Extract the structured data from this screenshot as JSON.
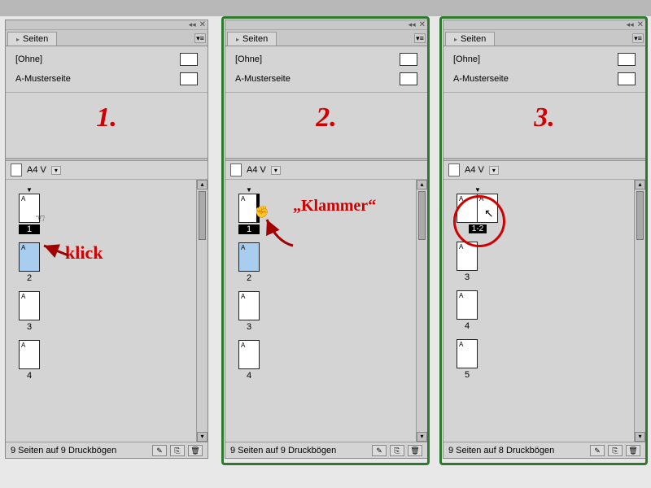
{
  "panel_title": "Seiten",
  "masters": {
    "none": "[Ohne]",
    "master_a": "A-Musterseite"
  },
  "format": {
    "label": "A4 V"
  },
  "steps": {
    "s1": "1.",
    "s2": "2.",
    "s3": "3."
  },
  "annotations": {
    "klick": "klick",
    "klammer": "„Klammer“"
  },
  "panel1": {
    "footer": "9 Seiten auf 9 Druckbögen",
    "pages": [
      {
        "num": "1",
        "master": "A",
        "selected": false,
        "inv": true
      },
      {
        "num": "2",
        "master": "A",
        "selected": true
      },
      {
        "num": "3",
        "master": "A",
        "selected": false
      },
      {
        "num": "4",
        "master": "A",
        "selected": false
      }
    ]
  },
  "panel2": {
    "footer": "9 Seiten auf 9 Druckbögen",
    "pages": [
      {
        "num": "1",
        "master": "A",
        "selected": false,
        "inv": true
      },
      {
        "num": "2",
        "master": "A",
        "selected": true
      },
      {
        "num": "3",
        "master": "A",
        "selected": false
      },
      {
        "num": "4",
        "master": "A",
        "selected": false
      }
    ]
  },
  "panel3": {
    "footer": "9 Seiten auf 8 Druckbögen",
    "spread": {
      "label": "1-2",
      "left": "A",
      "right": "A"
    },
    "pages": [
      {
        "num": "3",
        "master": "A"
      },
      {
        "num": "4",
        "master": "A"
      },
      {
        "num": "5",
        "master": "A"
      }
    ]
  }
}
